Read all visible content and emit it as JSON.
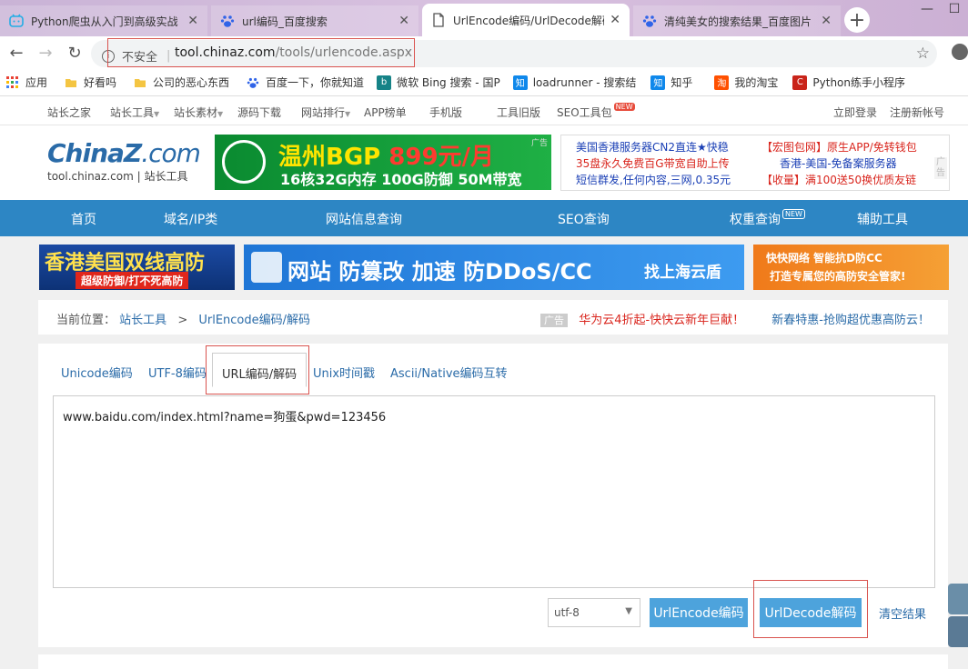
{
  "browser": {
    "tabs": [
      {
        "title": "Python爬虫从入门到高级实战",
        "icon": "bilibili-icon",
        "active": false
      },
      {
        "title": "url编码_百度搜索",
        "icon": "baidu-paw-icon",
        "active": false
      },
      {
        "title": "UrlEncode编码/UrlDecode解码",
        "icon": "document-icon",
        "active": true
      },
      {
        "title": "清纯美女的搜索结果_百度图片",
        "icon": "baidu-paw-icon",
        "active": false
      }
    ],
    "new_tab": "+",
    "address": {
      "security_label": "不安全",
      "host": "tool.chinaz.com",
      "path": "/tools/urlencode.aspx"
    },
    "bookmarks": [
      {
        "label": "应用",
        "icon": "apps-grid-icon",
        "color": "#e94235"
      },
      {
        "label": "好看吗",
        "icon": "folder-icon",
        "color": "#f4c542"
      },
      {
        "label": "公司的恶心东西",
        "icon": "folder-icon",
        "color": "#f4c542"
      },
      {
        "label": "百度一下，你就知道",
        "icon": "baidu-paw-icon",
        "color": "#3064e8"
      },
      {
        "label": "微软 Bing 搜索 - 国P",
        "icon": "bing-icon",
        "color": "#168387"
      },
      {
        "label": "loadrunner - 搜索结",
        "icon": "zhihu-icon",
        "color": "#0f88eb"
      },
      {
        "label": "知乎",
        "icon": "zhihu-icon",
        "color": "#0f88eb"
      },
      {
        "label": "我的淘宝",
        "icon": "taobao-icon",
        "color": "#ff5000"
      },
      {
        "label": "Python练手小程序",
        "icon": "csdn-icon",
        "color": "#c9241a"
      }
    ]
  },
  "site": {
    "top_links": [
      "站长之家",
      "站长工具",
      "站长素材",
      "源码下载",
      "网站排行",
      "APP榜单",
      "手机版",
      "工具旧版",
      "SEO工具包"
    ],
    "top_new_badge": "NEW",
    "login": "立即登录",
    "register": "注册新帐号",
    "logo_main": "ChinaZ",
    "logo_suffix": ".com",
    "logo_sub": "tool.chinaz.com | 站长工具",
    "ad_banner": {
      "line1_a": "温州BGP",
      "line1_b": "899元/月",
      "line2": "16核32G内存 100G防御 50M带宽",
      "tag": "广告"
    },
    "text_ads": [
      "美国香港服务器CN2直连★快稳",
      "35盘永久免费百G带宽自助上传",
      "短信群发,任何内容,三网,0.35元",
      "【宏图包网】原生APP/免转钱包",
      "香港-美国-免备案服务器",
      "【收量】满100送50换优质友链"
    ],
    "text_ad_tag": "广告",
    "nav": [
      "首页",
      "域名/IP类",
      "网站信息查询",
      "SEO查询",
      "权重查询",
      "辅助工具"
    ],
    "nav_new_badge": "NEW",
    "banners": [
      {
        "text1": "香港美国双线高防",
        "text2": "超级防御/打不死高防"
      },
      {
        "text1": "网站 防篡改 加速 防DDoS/CC",
        "text2": "找上海云盾"
      },
      {
        "text1": "快快网络 智能抗D防CC",
        "text2": "打造专属您的高防安全管家!"
      }
    ],
    "breadcrumb": {
      "prefix": "当前位置：",
      "home": "站长工具",
      "sep": ">",
      "current": "UrlEncode编码/解码"
    },
    "crumb_ad_tag": "广告",
    "crumb_ads": [
      "华为云4折起-快快云新年巨献！",
      "新春特惠-抢购超优惠高防云！"
    ]
  },
  "tool": {
    "tabs": [
      "Unicode编码",
      "UTF-8编码",
      "URL编码/解码",
      "Unix时间戳",
      "Ascii/Native编码互转"
    ],
    "selected_tab": "URL编码/解码",
    "input_value": "www.baidu.com/index.html?name=狗蛋&pwd=123456",
    "encoding": "utf-8",
    "encode_button": "UrlEncode编码",
    "decode_button": "UrlDecode解码",
    "clear_button": "清空结果"
  },
  "colors": {
    "nav_blue": "#2d86c4",
    "button_blue": "#4da3dc",
    "link_blue": "#2a6ba8",
    "highlight_red": "#d9534f",
    "ad_red": "#d9251d"
  }
}
